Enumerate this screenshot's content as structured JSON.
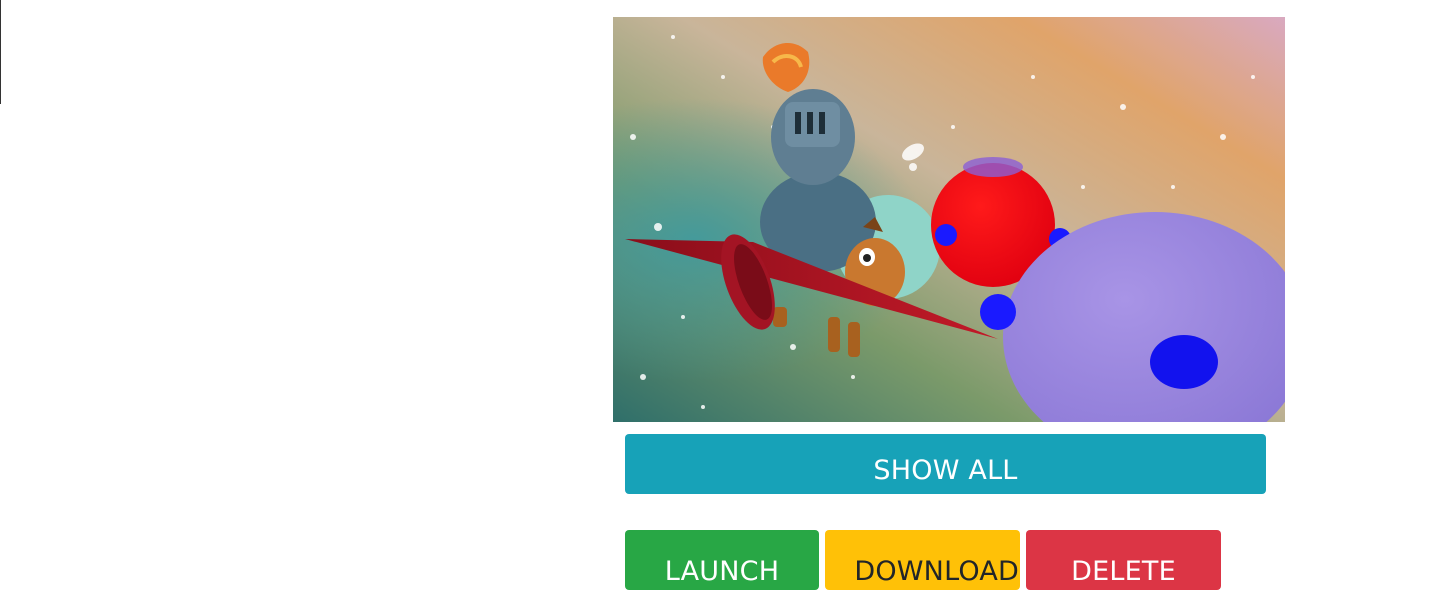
{
  "preview": {
    "description_icon": "game-screenshot-knight-on-pony-with-balloons"
  },
  "actions": {
    "show_all_label": "SHOW ALL",
    "launch_label": "LAUNCH",
    "download_label": "DOWNLOAD",
    "delete_label": "DELETE"
  },
  "colors": {
    "show_all": "#17a2b8",
    "launch": "#28a745",
    "download": "#ffc107",
    "delete": "#dc3545"
  }
}
